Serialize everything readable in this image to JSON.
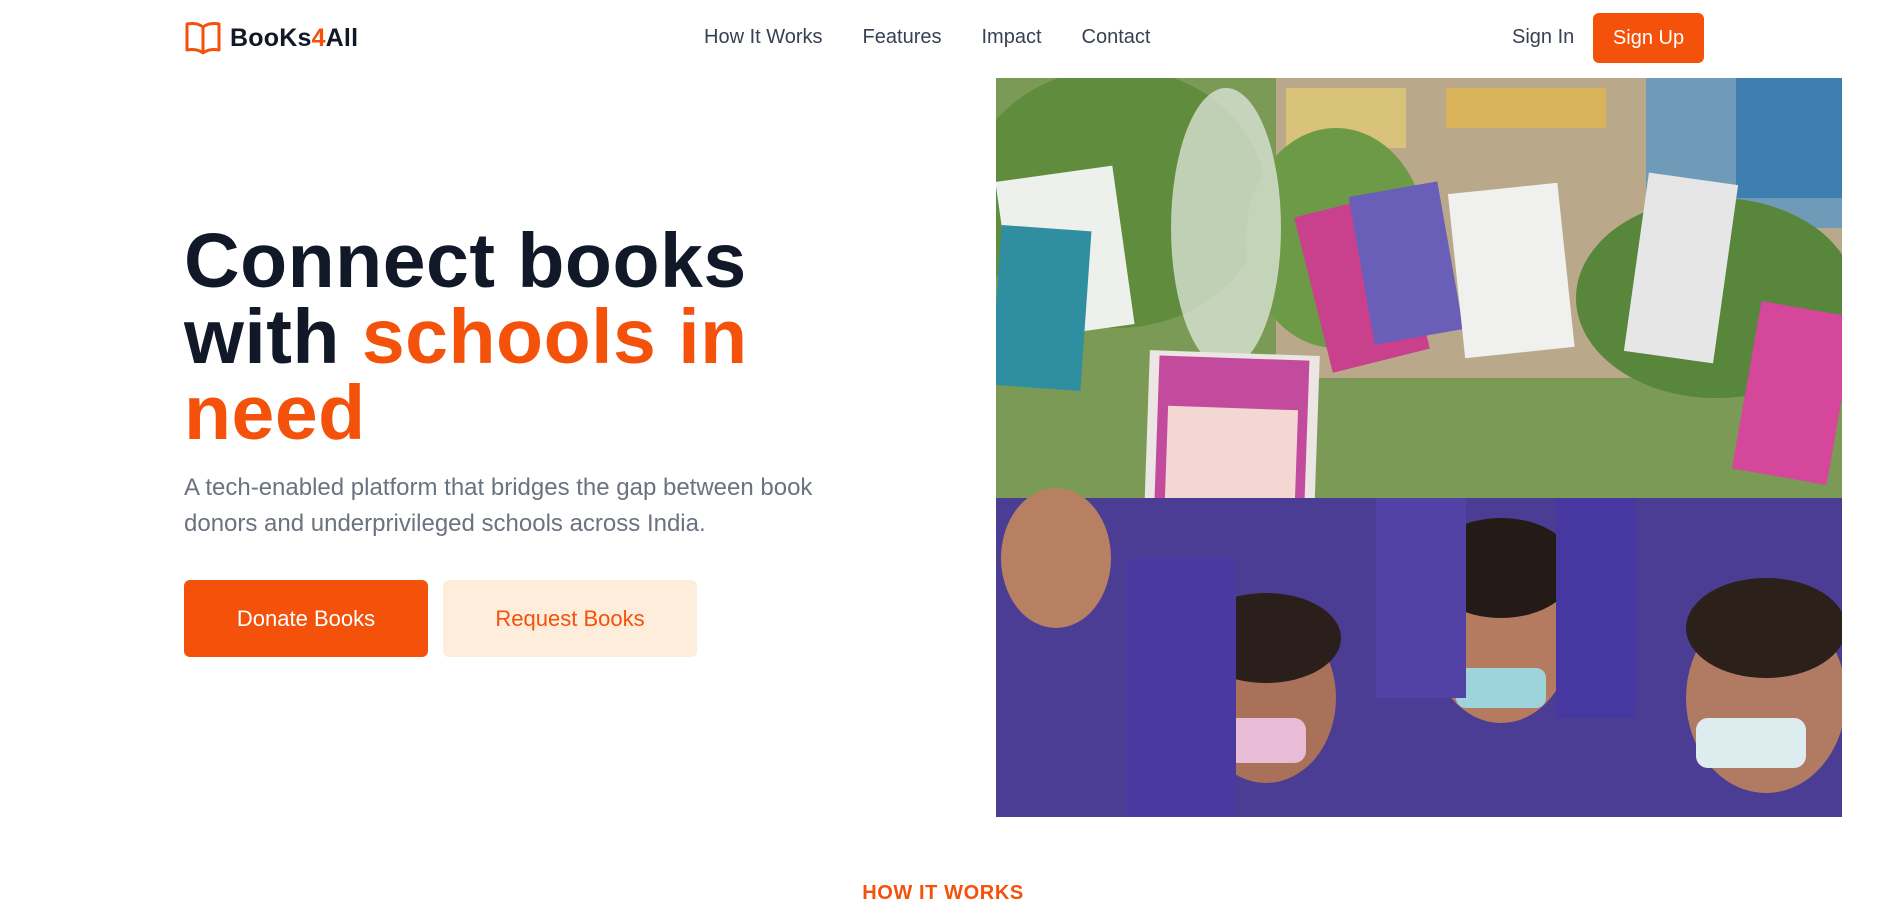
{
  "brand": {
    "name_part1": "BooKs",
    "name_accent": "4",
    "name_part2": "All",
    "icon": "open-book-icon",
    "accent_color": "#f4510b"
  },
  "nav": {
    "links": [
      "How It Works",
      "Features",
      "Impact",
      "Contact"
    ],
    "sign_in": "Sign In",
    "sign_up": "Sign Up"
  },
  "hero": {
    "title_line1": "Connect books",
    "title_line2_plain": "with ",
    "title_line2_accent": "schools in",
    "title_line3_accent": "need",
    "subtitle": "A tech-enabled platform that bridges the gap between book donors and underprivileged schools across India.",
    "primary_button": "Donate Books",
    "secondary_button": "Request Books",
    "photo_alt": "students-holding-books-photo"
  },
  "how_it_works": {
    "kicker": "HOW IT WORKS"
  },
  "colors": {
    "accent": "#f4510b",
    "heading": "#111827",
    "body_text": "#6b7280",
    "secondary_button_bg": "#feeddb"
  }
}
